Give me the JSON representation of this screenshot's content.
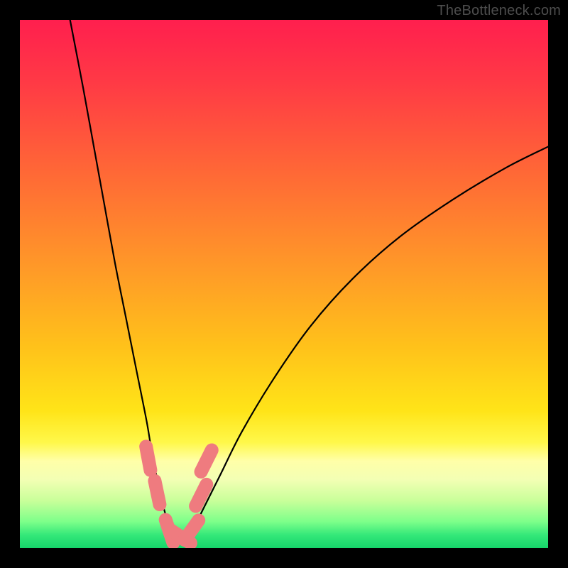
{
  "watermark": "TheBottleneck.com",
  "chart_data": {
    "type": "line",
    "title": "",
    "xlabel": "",
    "ylabel": "",
    "xlim": [
      0,
      100
    ],
    "ylim": [
      0,
      100
    ],
    "grid": false,
    "legend": false,
    "background_gradient": {
      "stops": [
        {
          "offset": 0.0,
          "color": "#ff1f4e"
        },
        {
          "offset": 0.12,
          "color": "#ff3a45"
        },
        {
          "offset": 0.3,
          "color": "#ff6b35"
        },
        {
          "offset": 0.48,
          "color": "#ff9c27"
        },
        {
          "offset": 0.62,
          "color": "#ffc21a"
        },
        {
          "offset": 0.74,
          "color": "#ffe418"
        },
        {
          "offset": 0.8,
          "color": "#fff84a"
        },
        {
          "offset": 0.835,
          "color": "#ffffa8"
        },
        {
          "offset": 0.87,
          "color": "#f3ffb4"
        },
        {
          "offset": 0.91,
          "color": "#c9ff9a"
        },
        {
          "offset": 0.95,
          "color": "#7dff8a"
        },
        {
          "offset": 0.975,
          "color": "#34e879"
        },
        {
          "offset": 1.0,
          "color": "#16d46a"
        }
      ]
    },
    "series": [
      {
        "name": "bottleneck-curve",
        "color": "#000000",
        "x": [
          9.5,
          12,
          14,
          16,
          18,
          20,
          22,
          24,
          25,
          26,
          27,
          28,
          29,
          30,
          31,
          32,
          33,
          35,
          38,
          42,
          48,
          55,
          63,
          72,
          82,
          92,
          100
        ],
        "y": [
          100,
          87,
          76,
          65,
          54,
          44,
          34,
          24,
          18,
          13,
          8.5,
          5,
          2.5,
          1.3,
          1.2,
          2,
          4,
          8,
          14,
          22,
          32,
          42,
          51,
          59,
          66,
          72,
          76
        ]
      }
    ],
    "markers": [
      {
        "name": "marker-left-upper",
        "x": 24.3,
        "y": 17.0,
        "color": "#ef7b7f"
      },
      {
        "name": "marker-left-lower",
        "x": 26.0,
        "y": 10.5,
        "color": "#ef7b7f"
      },
      {
        "name": "marker-bottom-1",
        "x": 28.3,
        "y": 3.2,
        "color": "#ef7b7f"
      },
      {
        "name": "marker-bottom-2",
        "x": 30.4,
        "y": 2.2,
        "color": "#ef7b7f"
      },
      {
        "name": "marker-bottom-3",
        "x": 32.5,
        "y": 3.4,
        "color": "#ef7b7f"
      },
      {
        "name": "marker-right-lower",
        "x": 34.3,
        "y": 10.0,
        "color": "#ef7b7f"
      },
      {
        "name": "marker-right-upper",
        "x": 35.3,
        "y": 16.5,
        "color": "#ef7b7f"
      }
    ]
  }
}
